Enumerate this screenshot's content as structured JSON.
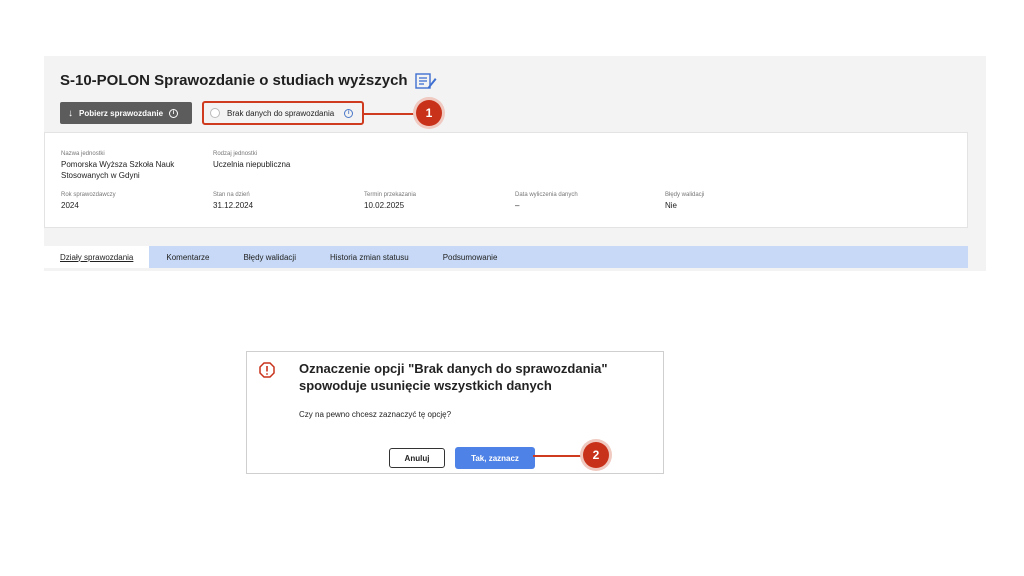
{
  "header": {
    "title": "S-10-POLON Sprawozdanie o studiach wyższych",
    "download_label": "Pobierz sprawozdanie",
    "no_data_label": "Brak danych do sprawozdania"
  },
  "annotations": {
    "step1": "1",
    "step2": "2",
    "accent_color": "#c9321a"
  },
  "info": {
    "unit_name_label": "Nazwa jednostki",
    "unit_name_line1": "Pomorska Wyższa Szkoła Nauk",
    "unit_name_line2": "Stosowanych w Gdyni",
    "unit_type_label": "Rodzaj jednostki",
    "unit_type_value": "Uczelnia niepubliczna",
    "year_label": "Rok sprawozdawczy",
    "year_value": "2024",
    "state_label": "Stan na dzień",
    "state_value": "31.12.2024",
    "deadline_label": "Termin przekazania",
    "deadline_value": "10.02.2025",
    "calc_label": "Data wyliczenia danych",
    "calc_value": "–",
    "errors_label": "Błędy walidacji",
    "errors_value": "Nie"
  },
  "tabs": [
    {
      "label": "Działy sprawozdania"
    },
    {
      "label": "Komentarze"
    },
    {
      "label": "Błędy walidacji"
    },
    {
      "label": "Historia zmian statusu"
    },
    {
      "label": "Podsumowanie"
    }
  ],
  "dialog": {
    "title_line1": "Oznaczenie opcji \"Brak danych do sprawozdania\"",
    "title_line2": "spowoduje usunięcie wszystkich danych",
    "question": "Czy na pewno chcesz zaznaczyć tę opcję?",
    "cancel_label": "Anuluj",
    "confirm_label": "Tak, zaznacz"
  },
  "icons": {
    "info": "i",
    "download": "↓"
  }
}
